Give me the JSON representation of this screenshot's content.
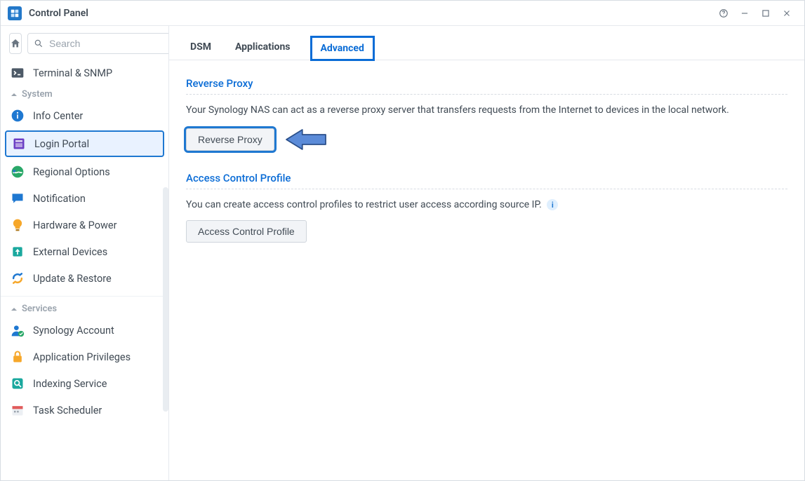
{
  "window": {
    "title": "Control Panel"
  },
  "search": {
    "placeholder": "Search"
  },
  "sidebar": {
    "terminal_snmp": "Terminal & SNMP",
    "groups": {
      "system": {
        "label": "System",
        "items": {
          "info_center": "Info Center",
          "login_portal": "Login Portal",
          "regional_options": "Regional Options",
          "notification": "Notification",
          "hardware_power": "Hardware & Power",
          "external_devices": "External Devices",
          "update_restore": "Update & Restore"
        }
      },
      "services": {
        "label": "Services",
        "items": {
          "synology_account": "Synology Account",
          "application_privileges": "Application Privileges",
          "indexing_service": "Indexing Service",
          "task_scheduler": "Task Scheduler"
        }
      }
    }
  },
  "tabs": {
    "dsm": "DSM",
    "applications": "Applications",
    "advanced": "Advanced"
  },
  "sections": {
    "reverse_proxy": {
      "title": "Reverse Proxy",
      "desc": "Your Synology NAS can act as a reverse proxy server that transfers requests from the Internet to devices in the local network.",
      "button": "Reverse Proxy"
    },
    "access_control": {
      "title": "Access Control Profile",
      "desc": "You can create access control profiles to restrict user access according source IP.",
      "button": "Access Control Profile"
    }
  }
}
